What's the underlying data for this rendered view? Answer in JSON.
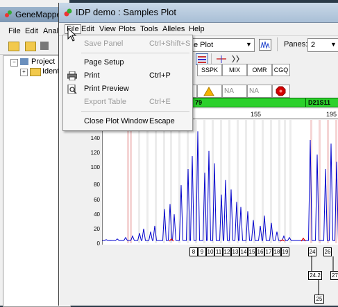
{
  "bg_window": {
    "title": "GeneMappe",
    "menu": [
      "File",
      "Edit",
      "Anal"
    ],
    "tree": {
      "root": "Project",
      "child": "Ident"
    }
  },
  "window": {
    "title": "IDP demo : Samples Plot",
    "menu": [
      "File",
      "Edit",
      "View",
      "Plots",
      "Tools",
      "Alleles",
      "Help"
    ],
    "toolbar": {
      "plot_combo_value": "e Plot",
      "panes_label": "Panes:",
      "panes_value": "2"
    },
    "quality_headers": [
      "SSPK",
      "MIX",
      "OMR",
      "CGQ"
    ],
    "quality_values": [
      "NA",
      "NA"
    ],
    "markers": {
      "left_visible": "79",
      "right": "D21S11"
    },
    "ruler": {
      "ticks": [
        "155",
        "195"
      ]
    },
    "y_axis": {
      "ticks": [
        "140",
        "120",
        "100",
        "80",
        "60",
        "40",
        "20",
        "0"
      ]
    },
    "bins_row1": [
      "8",
      "9",
      "10",
      "11",
      "12",
      "13",
      "14",
      "15",
      "16",
      "17",
      "18",
      "19",
      "24",
      "26"
    ],
    "bins_row2": [
      "24.2",
      "27"
    ],
    "bins_row3": [
      "25"
    ]
  },
  "file_menu": {
    "items": [
      {
        "label": "Save Panel",
        "shortcut": "Ctrl+Shift+S",
        "enabled": false
      },
      {
        "label": "Page Setup",
        "shortcut": "",
        "enabled": true
      },
      {
        "label": "Print",
        "shortcut": "Ctrl+P",
        "enabled": true,
        "icon": "printer-icon"
      },
      {
        "label": "Print Preview",
        "shortcut": "",
        "enabled": true,
        "icon": "print-preview-icon"
      },
      {
        "label": "Export Table",
        "shortcut": "Ctrl+E",
        "enabled": false
      },
      {
        "label": "Close Plot Window",
        "shortcut": "Escape",
        "enabled": true
      }
    ]
  },
  "colors": {
    "green_marker": "#2cd12c",
    "trace_blue": "#0000cc",
    "peak_red": "#e00000",
    "title_bar": "#b8cce0"
  }
}
